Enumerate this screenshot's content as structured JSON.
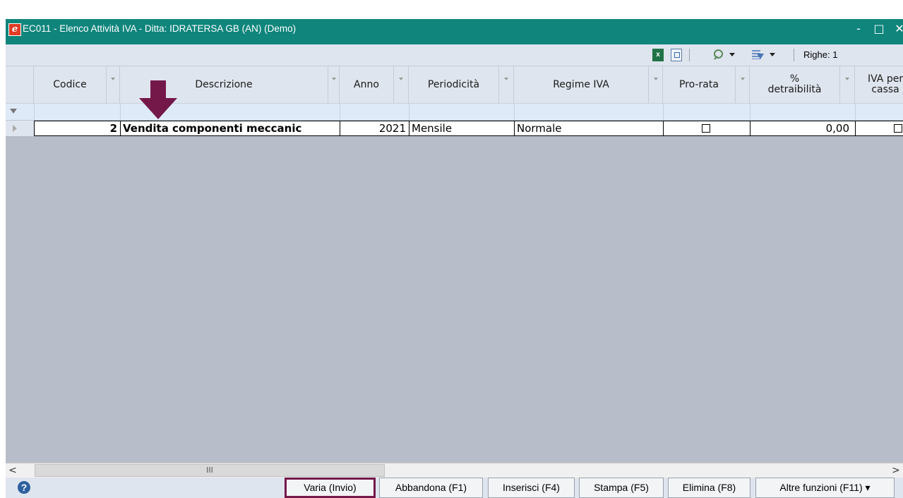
{
  "window": {
    "title": "EC011 - Elenco Attività IVA - Ditta: IDRATERSA GB (AN)  (Demo)",
    "minimize_glyph": "-",
    "maximize_glyph": "□",
    "close_glyph": "✕",
    "titlebar_color": "#0f857c"
  },
  "toolbar": {
    "excel_icon": "excel-export-icon",
    "excel_icon_text": "x",
    "righe_label": "Righe: 1"
  },
  "grid": {
    "columns": [
      "Codice",
      "Descrizione",
      "Anno",
      "Periodicità",
      "Regime IVA",
      "Pro-rata",
      "%\ndetraibilità",
      "IVA per\ncassa"
    ],
    "rows": [
      {
        "codice": "2",
        "descrizione": "Vendita componenti meccanic",
        "anno": "2021",
        "periodicita": "Mensile",
        "regime_iva": "Normale",
        "pro_rata": false,
        "detraibilita": "0,00",
        "iva_per_cassa": false
      }
    ]
  },
  "scrollbar": {
    "left_arrow": "<",
    "right_arrow": ">",
    "thumb_grip": "III"
  },
  "footer": {
    "help_glyph": "?",
    "buttons": [
      "Varia (Invio)",
      "Abbandona (F1)",
      "Inserisci (F4)",
      "Stampa (F5)",
      "Elimina (F8)",
      "Altre funzioni (F11) ▾"
    ],
    "highlight_color": "#74184a"
  },
  "annotation": {
    "arrow_color": "#74184a"
  }
}
